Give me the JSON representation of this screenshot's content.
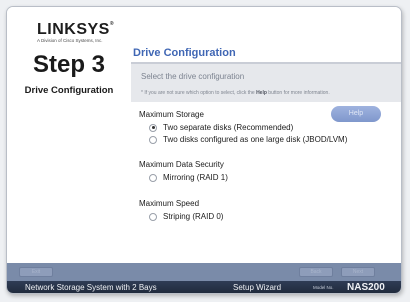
{
  "logo": {
    "word": "LINKSYS",
    "reg": "®",
    "subtitle": "A Division of Cisco Systems, Inc."
  },
  "step": {
    "title": "Step 3",
    "subtitle": "Drive Configuration"
  },
  "header": {
    "title": "Drive Configuration",
    "description": "Select the drive configuration",
    "hint_pre": "* If you are not sure which option to select, click the ",
    "hint_bold": "Help",
    "hint_post": " button for more information."
  },
  "help_button": "Help",
  "groups": [
    {
      "title": "Maximum Storage",
      "options": [
        {
          "label": "Two separate disks (Recommended)",
          "checked": true
        },
        {
          "label": "Two disks configured as one large disk (JBOD/LVM)",
          "checked": false
        }
      ]
    },
    {
      "title": "Maximum Data Security",
      "options": [
        {
          "label": "Mirroring (RAID 1)",
          "checked": false
        }
      ]
    },
    {
      "title": "Maximum Speed",
      "options": [
        {
          "label": "Striping (RAID 0)",
          "checked": false
        }
      ]
    }
  ],
  "buttons": {
    "exit": "Exit",
    "back": "Back",
    "next": "Next"
  },
  "footer": {
    "product": "Network Storage System with 2 Bays",
    "wizard": "Setup Wizard",
    "model_label": "Model No.",
    "model": "NAS200"
  }
}
